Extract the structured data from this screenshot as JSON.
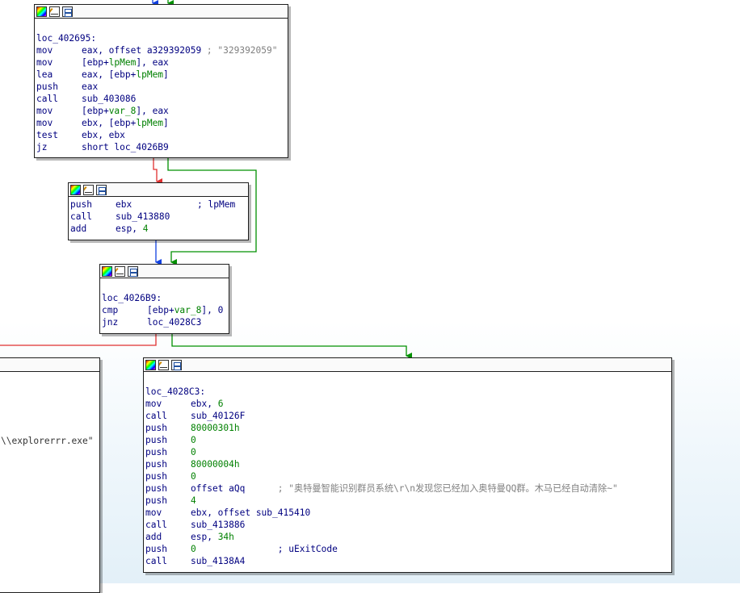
{
  "blocks": {
    "b1": {
      "lines": [
        {
          "label": "loc_402695:"
        },
        {
          "mn": "mov",
          "op": "eax, offset a329392059",
          "comment": " ; \"329392059\"",
          "comment_gray": true
        },
        {
          "mn": "mov",
          "op_pre": "[ebp+",
          "op_var": "lpMem",
          "op_post": "], eax"
        },
        {
          "mn": "lea",
          "op_pre": "eax, [ebp+",
          "op_var": "lpMem",
          "op_post": "]"
        },
        {
          "mn": "push",
          "op": "eax"
        },
        {
          "mn": "call",
          "op": "sub_403086"
        },
        {
          "mn": "mov",
          "op_pre": "[ebp+",
          "op_var": "var_8",
          "op_post": "], eax"
        },
        {
          "mn": "mov",
          "op_pre": "ebx, [ebp+",
          "op_var": "lpMem",
          "op_post": "]"
        },
        {
          "mn": "test",
          "op": "ebx, ebx"
        },
        {
          "mn": "jz",
          "op": "short loc_4026B9"
        }
      ]
    },
    "b2": {
      "lines": [
        {
          "mn": "push",
          "op": "ebx",
          "comment": "            ; lpMem"
        },
        {
          "mn": "call",
          "op": "sub_413880"
        },
        {
          "mn": "add",
          "op_pre": "esp, ",
          "op_var": "4",
          "op_post": ""
        }
      ]
    },
    "b3": {
      "lines": [
        {
          "label": "loc_4026B9:"
        },
        {
          "mn": "cmp",
          "op_pre": "[ebp+",
          "op_var": "var_8",
          "op_post": "], 0"
        },
        {
          "mn": "jnz",
          "op": "loc_4028C3"
        }
      ]
    },
    "b4": {
      "lines": [
        {
          "label": "loc_4028C3:"
        },
        {
          "mn": "mov",
          "op_pre": "ebx, ",
          "op_var": "6",
          "op_post": ""
        },
        {
          "mn": "call",
          "op": "sub_40126F"
        },
        {
          "mn": "push",
          "op_pre": "",
          "op_var": "80000301h",
          "op_post": ""
        },
        {
          "mn": "push",
          "op_pre": "",
          "op_var": "0",
          "op_post": ""
        },
        {
          "mn": "push",
          "op_pre": "",
          "op_var": "0",
          "op_post": ""
        },
        {
          "mn": "push",
          "op_pre": "",
          "op_var": "80000004h",
          "op_post": ""
        },
        {
          "mn": "push",
          "op_pre": "",
          "op_var": "0",
          "op_post": ""
        },
        {
          "mn": "push",
          "op": "offset aQq",
          "comment": "      ; \"奥特曼智能识别群员系统\\r\\n发现您已经加入奥特曼QQ群。木马已经自动清除~\"",
          "comment_gray": true
        },
        {
          "mn": "push",
          "op_pre": "",
          "op_var": "4",
          "op_post": ""
        },
        {
          "mn": "mov",
          "op": "ebx, offset sub_415410"
        },
        {
          "mn": "call",
          "op": "sub_413886"
        },
        {
          "mn": "add",
          "op_pre": "esp, ",
          "op_var": "34h",
          "op_post": ""
        },
        {
          "mn": "push",
          "op_pre": "",
          "op_var": "0",
          "op_post": "",
          "comment": "               ; uExitCode"
        },
        {
          "mn": "call",
          "op": "sub_4138A4"
        }
      ]
    }
  },
  "partial_left": {
    "text": "\\\\explorerrr.exe\""
  },
  "watermark": "",
  "colors": {
    "edge_true": "#009000",
    "edge_false": "#e03030",
    "edge_uncond": "#1040e0",
    "mnemonic": "#000080",
    "variable": "#008000",
    "comment": "#808080"
  }
}
